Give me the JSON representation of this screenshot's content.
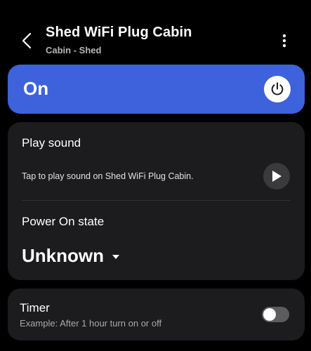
{
  "header": {
    "title": "Shed WiFi Plug Cabin",
    "subtitle": "Cabin - Shed",
    "back_icon": "chevron-left-icon",
    "menu_icon": "more-vertical-icon"
  },
  "power": {
    "state_label": "On",
    "is_on": true,
    "icon": "power-icon",
    "color": "#3d62db"
  },
  "play_sound": {
    "title": "Play sound",
    "description": "Tap to play sound on Shed WiFi Plug Cabin.",
    "icon": "play-icon"
  },
  "power_on_state": {
    "title": "Power On state",
    "selected": "Unknown",
    "icon": "caret-down-icon"
  },
  "timer": {
    "title": "Timer",
    "description": "Example: After 1 hour turn on or off",
    "enabled": false
  },
  "colors": {
    "background": "#000000",
    "card": "#1c1c1e",
    "accent": "#3d62db"
  }
}
